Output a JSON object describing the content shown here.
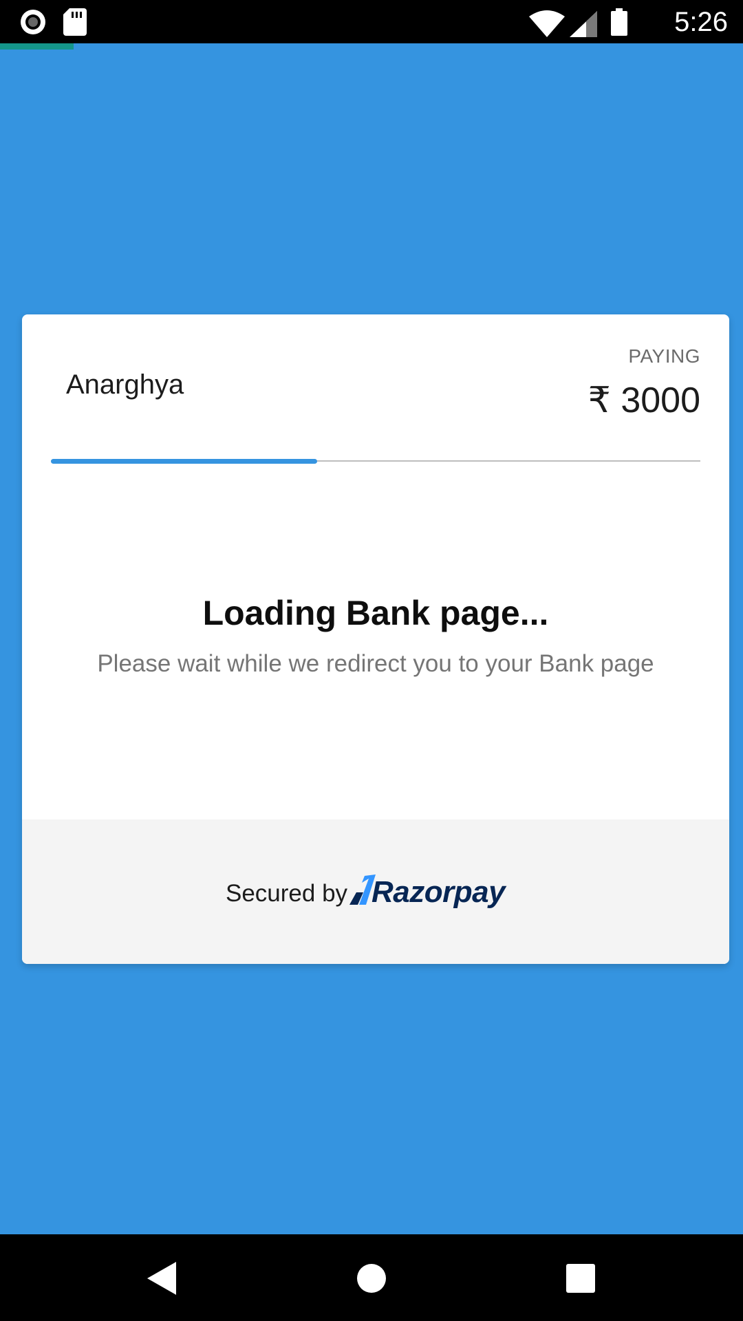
{
  "status_bar": {
    "time": "5:26",
    "icons": [
      "record-icon",
      "sd-card-icon",
      "wifi-icon",
      "cell-signal-icon",
      "battery-icon"
    ]
  },
  "payment": {
    "merchant_name": "Anarghya",
    "paying_label": "PAYING",
    "amount": "₹ 3000",
    "progress": 0.41
  },
  "loading": {
    "title": "Loading Bank page...",
    "subtitle": "Please wait while we redirect you to your Bank page"
  },
  "footer": {
    "secured_by": "Secured by",
    "brand": "Razorpay"
  },
  "nav_bar": {
    "buttons": [
      "back-icon",
      "home-icon",
      "recents-icon"
    ]
  },
  "colors": {
    "background": "#3594e0",
    "accent": "#3594e0",
    "top_accent": "#14968a",
    "brand_text": "#072654",
    "brand_mark": "#3395ff"
  }
}
